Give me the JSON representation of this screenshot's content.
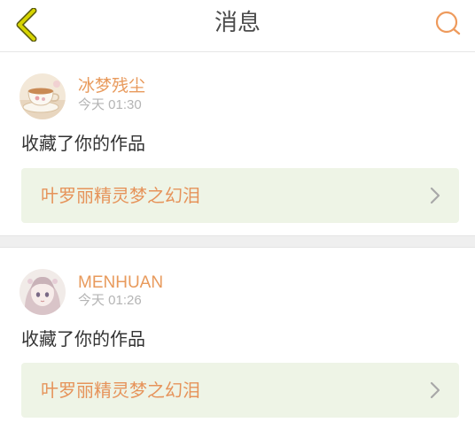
{
  "header": {
    "title": "消息",
    "back_icon": "chevron-left-icon",
    "search_icon": "search-icon"
  },
  "colors": {
    "accent": "#e6935a",
    "back_arrow": "#d6d400",
    "card_link_bg": "#eef4e6",
    "separator": "#efefef"
  },
  "notifications": [
    {
      "username": "冰梦残尘",
      "time": "今天 01:30",
      "action": "收藏了你的作品",
      "work_title": "叶罗丽精灵梦之幻泪",
      "avatar_icon": "teacup-avatar"
    },
    {
      "username": "MENHUAN",
      "time": "今天 01:26",
      "action": "收藏了你的作品",
      "work_title": "叶罗丽精灵梦之幻泪",
      "avatar_icon": "anime-girl-avatar"
    }
  ]
}
